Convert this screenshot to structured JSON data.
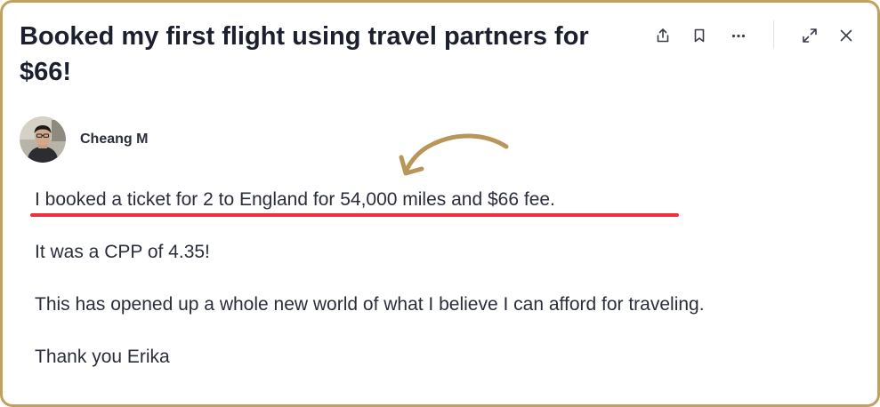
{
  "post": {
    "title": "Booked my first flight using travel partners for $66!",
    "author": {
      "name": "Cheang M"
    },
    "body": [
      "I booked a ticket for 2 to England for 54,000 miles and $66 fee.",
      "It was a CPP of 4.35!",
      "This has opened up a whole new world of what I believe I can afford for traveling.",
      "Thank you Erika"
    ]
  },
  "toolbar": {
    "icons": [
      "share-icon",
      "bookmark-icon",
      "more-icon",
      "expand-icon",
      "close-icon"
    ]
  },
  "colors": {
    "frame": "#c2a15f",
    "annotation_arrow": "#b8965a",
    "highlight_underline": "#ef2f3c",
    "text": "#2a2e3b",
    "title": "#1b1f2e"
  }
}
